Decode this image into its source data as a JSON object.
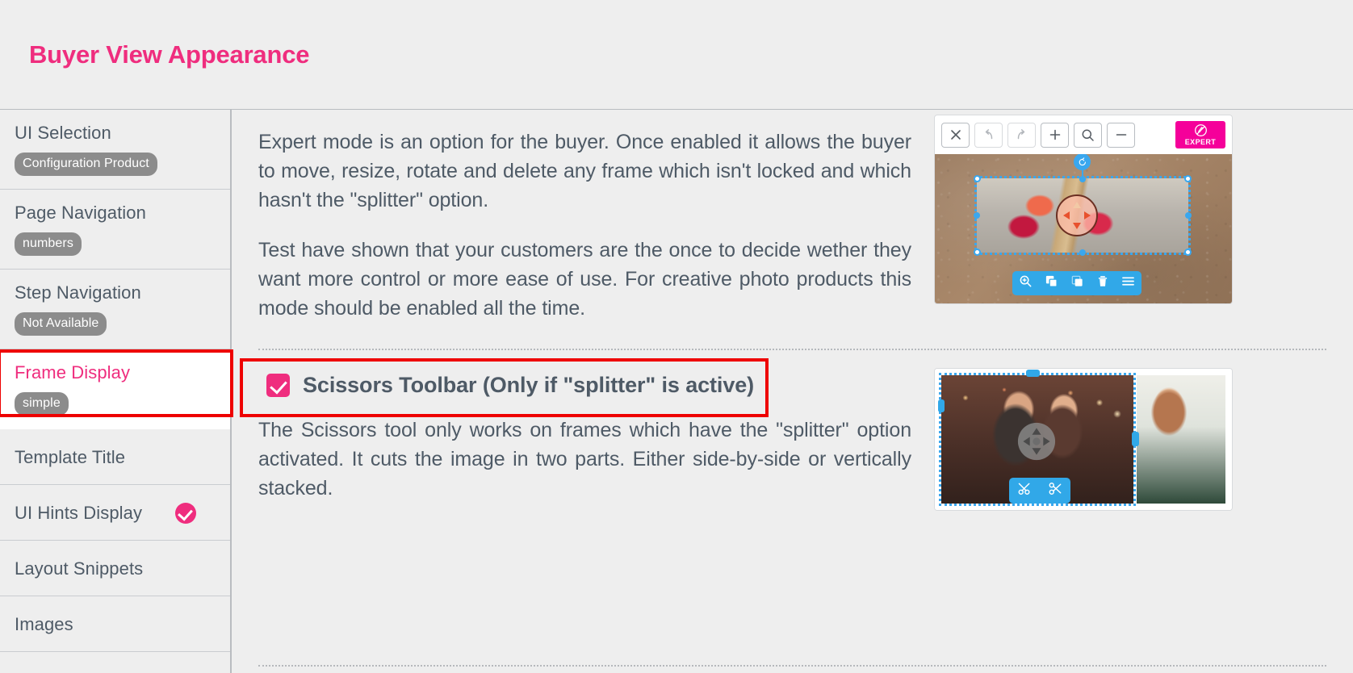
{
  "header": {
    "title": "Buyer View Appearance"
  },
  "sidebar": {
    "items": [
      {
        "label": "UI Selection",
        "badge": "Configuration Product",
        "active": false,
        "check": false
      },
      {
        "label": "Page Navigation",
        "badge": "numbers",
        "active": false,
        "check": false
      },
      {
        "label": "Step Navigation",
        "badge": "Not Available",
        "active": false,
        "check": false
      },
      {
        "label": "Frame Display",
        "badge": "simple",
        "active": true,
        "check": false
      },
      {
        "label": "Template Title",
        "badge": "",
        "active": false,
        "check": false
      },
      {
        "label": "UI Hints Display",
        "badge": "",
        "active": false,
        "check": true
      },
      {
        "label": "Layout Snippets",
        "badge": "",
        "active": false,
        "check": false
      },
      {
        "label": "Images",
        "badge": "",
        "active": false,
        "check": false
      }
    ]
  },
  "main": {
    "expert_paragraph_1": "Expert mode is an option for the buyer. Once enabled it allows the buyer to move, resize, rotate and delete any frame which isn't locked and which hasn't the \"splitter\" option.",
    "expert_paragraph_2": "Test have shown that your customers are the once to decide wether they want more control or more ease of use. For creative photo products this mode should be enabled all the time.",
    "scissors_heading": "Scissors Toolbar (Only if \"splitter\" is active)",
    "scissors_paragraph": "The Scissors tool only works on frames which have the \"splitter\" option activated. It cuts the image in two parts. Either side-by-side or vertically stacked."
  },
  "editor_toolbar": {
    "buttons": [
      {
        "name": "close-icon",
        "glyph": "✕",
        "dim": false
      },
      {
        "name": "undo-icon",
        "glyph": "↶",
        "dim": true
      },
      {
        "name": "redo-icon",
        "glyph": "↷",
        "dim": true
      },
      {
        "name": "plus-icon",
        "glyph": "+",
        "dim": false
      },
      {
        "name": "search-icon",
        "glyph": "⚲",
        "dim": false
      },
      {
        "name": "minus-icon",
        "glyph": "−",
        "dim": false
      }
    ],
    "expert_label": "EXPERT"
  },
  "frame_toolbar": {
    "icons": [
      "zoom-in-icon",
      "duplicate-icon",
      "copy-icon",
      "trash-icon",
      "menu-icon"
    ]
  },
  "scissors_toolbar": {
    "icons": [
      "scissors-horizontal-icon",
      "scissors-vertical-icon"
    ]
  },
  "colors": {
    "accent_pink": "#ef2d7e",
    "expert_magenta": "#f5009a",
    "annotation_red": "#ee0000",
    "selection_blue": "#31a8e8",
    "text_slate": "#4e5a66",
    "badge_gray": "#8c8c8c",
    "page_bg": "#eeeeee"
  }
}
